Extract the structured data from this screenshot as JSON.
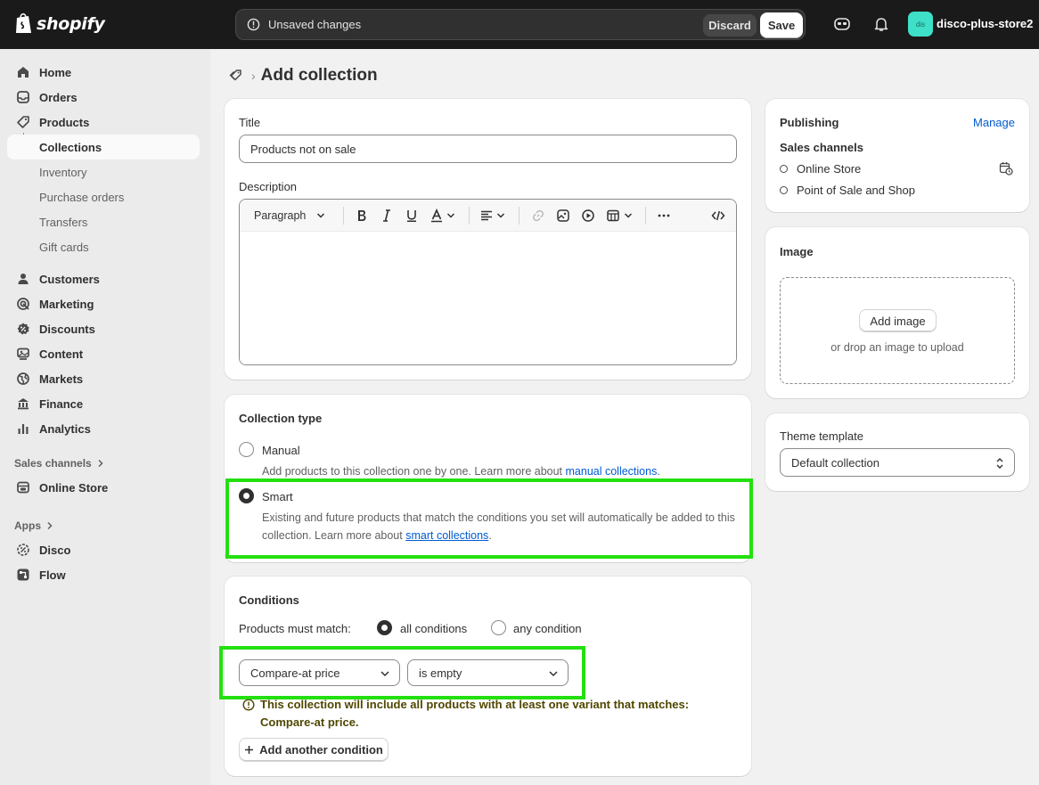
{
  "topbar": {
    "logo_text": "shopify",
    "unsaved_text": "Unsaved changes",
    "discard_label": "Discard",
    "save_label": "Save",
    "store_avatar": "dis",
    "store_name": "disco-plus-store2"
  },
  "sidebar": {
    "items": [
      {
        "label": "Home",
        "icon": "home-icon"
      },
      {
        "label": "Orders",
        "icon": "orders-icon"
      },
      {
        "label": "Products",
        "icon": "tag-icon"
      },
      {
        "label": "Collections"
      },
      {
        "label": "Inventory"
      },
      {
        "label": "Purchase orders"
      },
      {
        "label": "Transfers"
      },
      {
        "label": "Gift cards"
      },
      {
        "label": "Customers",
        "icon": "person-icon"
      },
      {
        "label": "Marketing",
        "icon": "target-icon"
      },
      {
        "label": "Discounts",
        "icon": "discount-icon"
      },
      {
        "label": "Content",
        "icon": "content-icon"
      },
      {
        "label": "Markets",
        "icon": "globe-icon"
      },
      {
        "label": "Finance",
        "icon": "bank-icon"
      },
      {
        "label": "Analytics",
        "icon": "bar-chart-icon"
      },
      {
        "label": "Online Store",
        "icon": "store-icon"
      },
      {
        "label": "Disco",
        "icon": "disco-icon"
      },
      {
        "label": "Flow",
        "icon": "flow-icon"
      }
    ],
    "sales_channels_label": "Sales channels",
    "apps_label": "Apps"
  },
  "page": {
    "title": "Add collection"
  },
  "title_card": {
    "title_label": "Title",
    "title_value": "Products not on sale",
    "description_label": "Description",
    "paragraph_label": "Paragraph"
  },
  "collection_type": {
    "heading": "Collection type",
    "manual_label": "Manual",
    "manual_help": "Add products to this collection one by one. Learn more about ",
    "manual_link": "manual collections",
    "smart_label": "Smart",
    "smart_help": "Existing and future products that match the conditions you set will automatically be added to this collection. Learn more about ",
    "smart_link": "smart collections"
  },
  "conditions": {
    "heading": "Conditions",
    "match_label": "Products must match:",
    "all_label": "all conditions",
    "any_label": "any condition",
    "field_value": "Compare-at price",
    "operator_value": "is empty",
    "notice_text": "This collection will include all products with at least one variant that matches: Compare-at price.",
    "add_condition_label": "Add another condition"
  },
  "publishing": {
    "heading": "Publishing",
    "manage_label": "Manage",
    "sales_channels_label": "Sales channels",
    "channels": [
      "Online Store",
      "Point of Sale and Shop"
    ]
  },
  "image_card": {
    "heading": "Image",
    "add_label": "Add image",
    "drop_text": "or drop an image to upload"
  },
  "theme": {
    "label": "Theme template",
    "value": "Default collection"
  },
  "colors": {
    "highlight": "#24e010",
    "link": "#005bd3",
    "avatar": "#3ee0c8"
  }
}
